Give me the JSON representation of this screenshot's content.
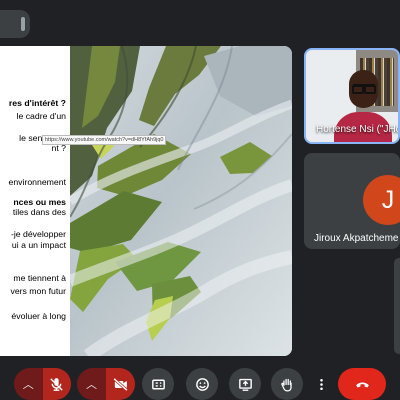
{
  "slide": {
    "lines": [
      {
        "text": "res d'intérêt ?",
        "bold": true
      },
      {
        "text": "le cadre d'un",
        "bold": false
      },
      {
        "text": "le sentiment",
        "bold": false
      },
      {
        "text": "nt ?",
        "bold": false
      },
      {
        "text": "environnement",
        "bold": false
      },
      {
        "text": "nces ou mes",
        "bold": true
      },
      {
        "text": "tiles dans des",
        "bold": false
      },
      {
        "text": "-je développer",
        "bold": false
      },
      {
        "text": "ui a un impact",
        "bold": false
      },
      {
        "text": "me tiennent à",
        "bold": false
      },
      {
        "text": "vers mon futur",
        "bold": false
      },
      {
        "text": "évoluer à long",
        "bold": false
      }
    ],
    "tooltip": "https://www.youtube.com/watch?v=dH8YfAh9jq0"
  },
  "participants": [
    {
      "name": "Hortense Nsi (\"JHor",
      "type": "video",
      "active": true
    },
    {
      "name": "Jiroux Akpatcheme",
      "initial": "J",
      "avatar_color": "#d2461b",
      "type": "avatar"
    }
  ],
  "controls": {
    "mic": {
      "state": "muted",
      "icon": "mic-off-icon"
    },
    "camera": {
      "state": "off",
      "icon": "camera-off-icon"
    },
    "buttons": [
      "captions-icon",
      "emoji-icon",
      "present-icon",
      "raise-hand-icon",
      "more-options-icon"
    ],
    "end_call_icon": "end-call-icon",
    "colors": {
      "background": "#202124",
      "muted": "#b3261e",
      "end": "#e1261c",
      "button": "#3c4043"
    }
  }
}
